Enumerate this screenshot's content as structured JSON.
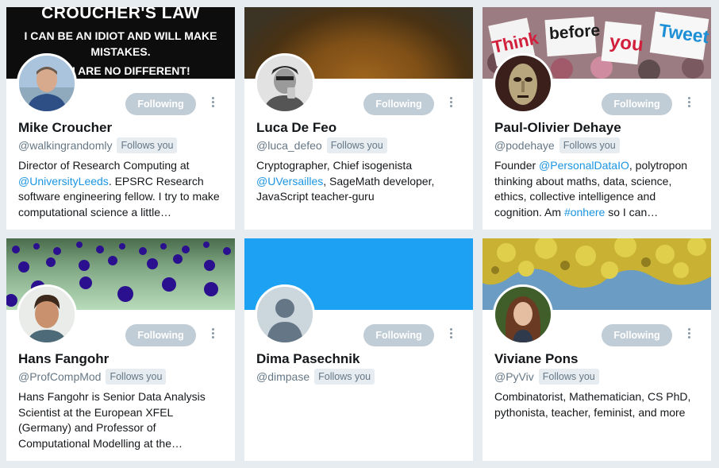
{
  "follow_button_label": "Following",
  "follows_you_label": "Follows you",
  "cards": [
    {
      "name": "Mike Croucher",
      "handle": "@walkingrandomly",
      "banner_text": [
        "CROUCHER'S LAW",
        "I CAN BE AN IDIOT AND WILL MAKE",
        "MISTAKES.",
        "YOU ARE NO DIFFERENT!"
      ],
      "bio": [
        "Director of Research Computing at ",
        {
          "link": "@UniversityLeeds"
        },
        ". EPSRC Research software engineering fellow. I try to make computational science a little…"
      ]
    },
    {
      "name": "Luca De Feo",
      "handle": "@luca_defeo",
      "bio": [
        "Cryptographer, Chief isogenista ",
        {
          "link": "@UVersailles"
        },
        ", SageMath developer, JavaScript teacher-guru"
      ]
    },
    {
      "name": "Paul-Olivier Dehaye",
      "handle": "@podehaye",
      "banner_text": [
        "Think",
        "before",
        "you",
        "Tweet"
      ],
      "bio": [
        "Founder ",
        {
          "link": "@PersonalDataIO"
        },
        ", polytropon thinking about maths, data, science, ethics, collective intelligence and cognition. Am ",
        {
          "link": "#onhere"
        },
        " so I can…"
      ]
    },
    {
      "name": "Hans Fangohr",
      "handle": "@ProfCompMod",
      "bio": [
        "Hans Fangohr is Senior Data Analysis Scientist at the European XFEL (Germany) and Professor of Computational Modelling at the…"
      ]
    },
    {
      "name": "Dima Pasechnik",
      "handle": "@dimpase",
      "bio": []
    },
    {
      "name": "Viviane Pons",
      "handle": "@PyViv",
      "bio": [
        "Combinatorist, Mathematician, CS PhD, pythonista, teacher, feminist, and more"
      ]
    }
  ]
}
